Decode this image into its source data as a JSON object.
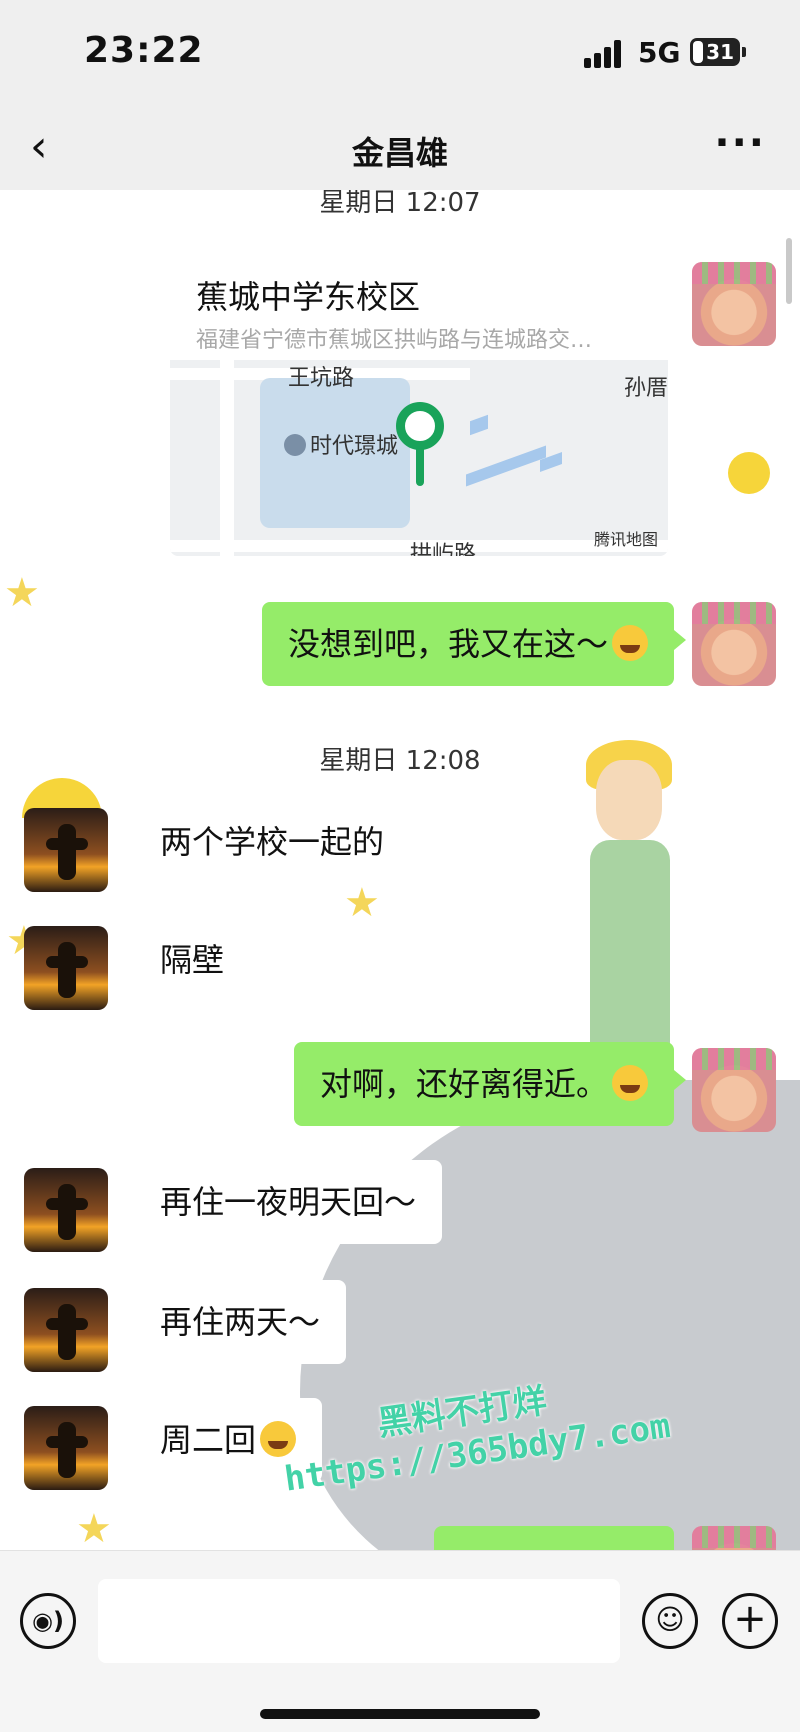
{
  "status_bar": {
    "time": "23:22",
    "network": "5G",
    "battery": "31"
  },
  "nav": {
    "back_icon": "‹",
    "title": "金昌雄",
    "more_icon": "···"
  },
  "messages": {
    "timestamp_1": "星期日 12:07",
    "location": {
      "title": "蕉城中学东校区",
      "address": "福建省宁德市蕉城区拱屿路与连城路交…",
      "map_labels": {
        "road_1": "王坑路",
        "road_2": "孙厝",
        "poi": "时代璟城",
        "road_3": "拱屿路",
        "provider": "腾讯地图"
      }
    },
    "msg_1": "没想到吧，我又在这～",
    "timestamp_2": "星期日 12:08",
    "msg_2": "两个学校一起的",
    "msg_3": "隔壁",
    "msg_4": "对啊，还好离得近。",
    "msg_5": "再住一夜明天回～",
    "msg_6": "再住两天～",
    "msg_7": "周二回"
  },
  "watermark": {
    "line_1": "黑料不打烊",
    "line_2": "https://365bdy7.com"
  },
  "input_bar": {
    "voice_icon": "voice-icon",
    "emoji_icon": "smile-icon",
    "plus_icon": "plus-icon"
  },
  "colors": {
    "my_bubble": "#95ec69",
    "their_bubble": "#ffffff",
    "bar_bg": "#efefef",
    "pin": "#19a35a"
  }
}
